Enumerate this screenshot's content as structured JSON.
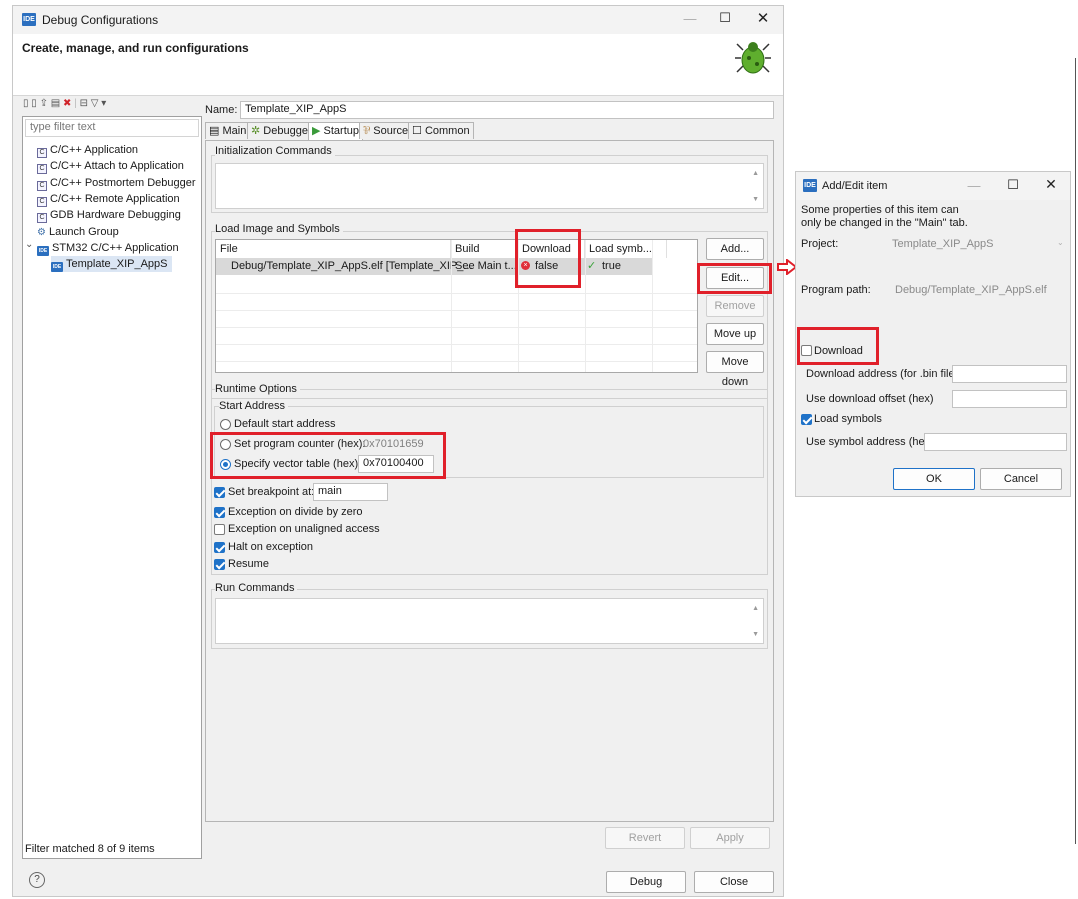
{
  "main_window": {
    "title": "Debug Configurations",
    "heading": "Create, manage, and run configurations",
    "filter_placeholder": "type filter text",
    "tree": [
      {
        "label": "C/C++ Application",
        "icon": "c-config-icon",
        "indent": 0
      },
      {
        "label": "C/C++ Attach to Application",
        "icon": "c-config-icon",
        "indent": 0
      },
      {
        "label": "C/C++ Postmortem Debugger",
        "icon": "c-config-icon",
        "indent": 0
      },
      {
        "label": "C/C++ Remote Application",
        "icon": "c-config-icon",
        "indent": 0
      },
      {
        "label": "GDB Hardware Debugging",
        "icon": "c-config-icon",
        "indent": 0
      },
      {
        "label": "Launch Group",
        "icon": "launch-group-icon",
        "indent": 0
      },
      {
        "label": "STM32 C/C++ Application",
        "icon": "ide-icon",
        "indent": 0
      },
      {
        "label": "Template_XIP_AppS",
        "icon": "ide-icon",
        "indent": 1
      }
    ],
    "filter_status": "Filter matched 8 of 9 items",
    "name_label": "Name:",
    "name_value": "Template_XIP_AppS",
    "tabs": [
      "Main",
      "Debugger",
      "Startup",
      "Source",
      "Common"
    ],
    "active_tab": "Startup",
    "init_commands_label": "Initialization Commands",
    "load_image_label": "Load Image and Symbols",
    "table": {
      "columns": [
        "File",
        "Build",
        "Download",
        "Load symb..."
      ],
      "rows": [
        {
          "file": "Debug/Template_XIP_AppS.elf [Template_XIP_...",
          "build": "See Main t...",
          "download": "false",
          "load_symbols": "true"
        }
      ]
    },
    "side_buttons": {
      "add": "Add...",
      "edit": "Edit...",
      "remove": "Remove",
      "move_up": "Move up",
      "move_down": "Move down"
    },
    "runtime_options_label": "Runtime Options",
    "start_address_label": "Start Address",
    "radio_default": "Default start address",
    "radio_pc": "Set program counter (hex):",
    "pc_value": "0x70101659",
    "radio_vector": "Specify vector table (hex):",
    "vector_value": "0x70100400",
    "set_breakpoint_label": "Set breakpoint at:",
    "breakpoint_value": "main",
    "exception_divide": "Exception on divide by zero",
    "exception_unaligned": "Exception on unaligned access",
    "halt_on_exception": "Halt on exception",
    "resume": "Resume",
    "run_commands_label": "Run Commands",
    "revert": "Revert",
    "apply": "Apply",
    "debug": "Debug",
    "close": "Close",
    "help_glyph": "?"
  },
  "dialog": {
    "title": "Add/Edit item",
    "note": "Some properties of this item can only be changed in the \"Main\" tab.",
    "project_label": "Project:",
    "project_value": "Template_XIP_AppS",
    "program_path_label": "Program path:",
    "program_path_value": "Debug/Template_XIP_AppS.elf",
    "download_label": "Download",
    "download_address_label": "Download address (for .bin file)",
    "download_offset_label": "Use download offset (hex)",
    "load_symbols_label": "Load symbols",
    "symbol_address_label": "Use symbol address (hex)",
    "ok": "OK",
    "cancel": "Cancel"
  },
  "ide_badge": "IDE",
  "colors": {
    "highlight": "#e0202a",
    "accent": "#1f72c8",
    "selected_row": "#d9d9d9"
  }
}
